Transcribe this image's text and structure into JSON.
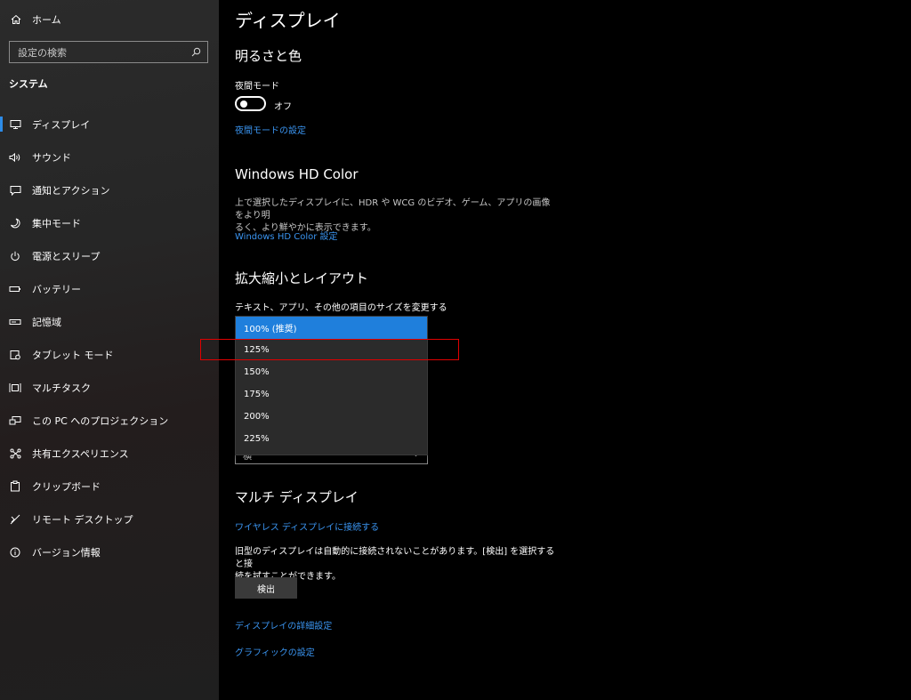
{
  "sidebar": {
    "home_label": "ホーム",
    "search_placeholder": "設定の検索",
    "section_title": "システム",
    "items": [
      {
        "label": "ディスプレイ",
        "icon": "monitor-icon"
      },
      {
        "label": "サウンド",
        "icon": "speaker-icon"
      },
      {
        "label": "通知とアクション",
        "icon": "notification-icon"
      },
      {
        "label": "集中モード",
        "icon": "moon-icon"
      },
      {
        "label": "電源とスリープ",
        "icon": "power-icon"
      },
      {
        "label": "バッテリー",
        "icon": "battery-icon"
      },
      {
        "label": "記憶域",
        "icon": "storage-icon"
      },
      {
        "label": "タブレット モード",
        "icon": "tablet-icon"
      },
      {
        "label": "マルチタスク",
        "icon": "multitask-icon"
      },
      {
        "label": "この PC へのプロジェクション",
        "icon": "projection-icon"
      },
      {
        "label": "共有エクスペリエンス",
        "icon": "share-icon"
      },
      {
        "label": "クリップボード",
        "icon": "clipboard-icon"
      },
      {
        "label": "リモート デスクトップ",
        "icon": "remote-icon"
      },
      {
        "label": "バージョン情報",
        "icon": "info-icon"
      }
    ],
    "active_index": 0
  },
  "main": {
    "title": "ディスプレイ",
    "brightness": {
      "heading": "明るさと色",
      "night_label": "夜間モード",
      "toggle_state": "オフ",
      "night_settings_link": "夜間モードの設定"
    },
    "hdr": {
      "heading": "Windows HD Color",
      "desc_line1": "上で選択したディスプレイに、HDR や WCG のビデオ、ゲーム、アプリの画像をより明",
      "desc_line2": "るく、より鮮やかに表示できます。",
      "link": "Windows HD Color 設定"
    },
    "scale": {
      "heading": "拡大縮小とレイアウト",
      "size_label": "テキスト、アプリ、その他の項目のサイズを変更する",
      "options": [
        "100% (推奨)",
        "125%",
        "150%",
        "175%",
        "200%",
        "225%"
      ],
      "selected_index": 0,
      "orientation_value": "横"
    },
    "multi": {
      "heading": "マルチ ディスプレイ",
      "wireless_link": "ワイヤレス ディスプレイに接続する",
      "desc_line1": "旧型のディスプレイは自動的に接続されないことがあります。[検出] を選択すると接",
      "desc_line2": "続を試すことができます。",
      "detect_button": "検出",
      "advanced_link": "ディスプレイの詳細設定",
      "graphics_link": "グラフィックの設定"
    }
  },
  "colors": {
    "accent": "#1f7fdc",
    "link": "#3a94f0",
    "highlight_box": "#e00000"
  }
}
